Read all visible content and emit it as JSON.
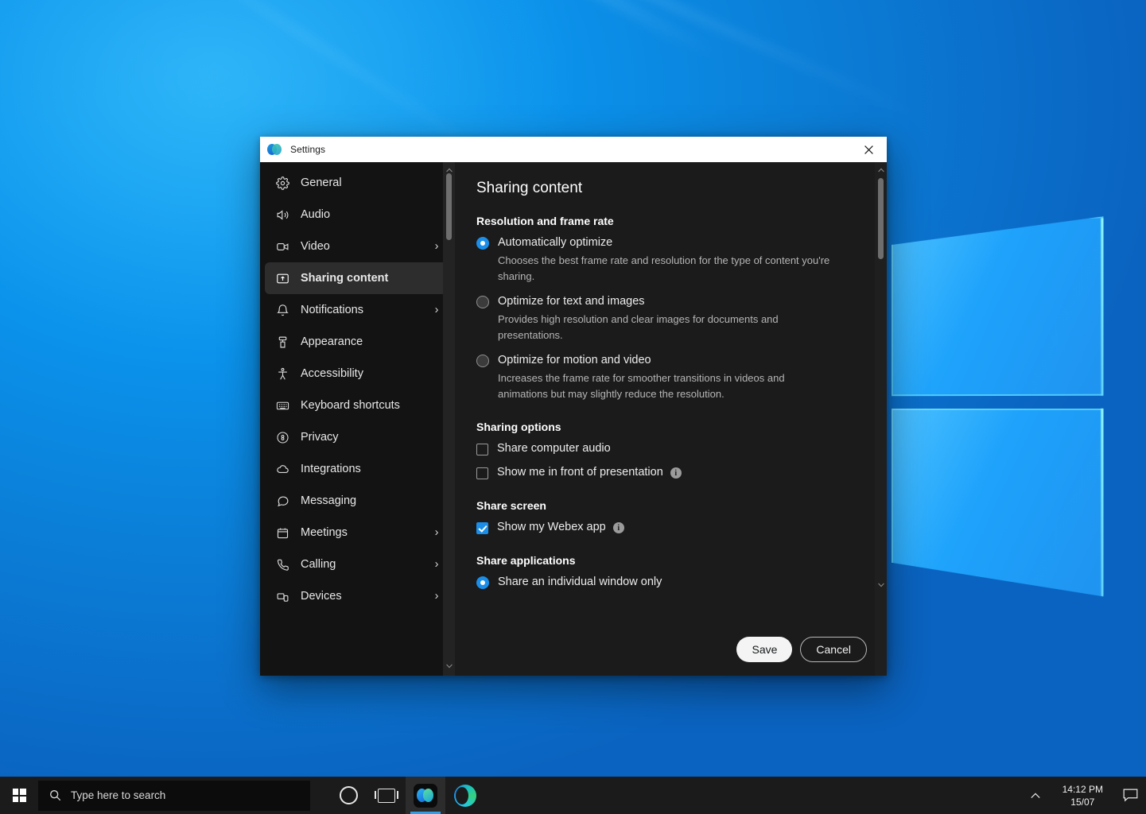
{
  "window": {
    "title": "Settings",
    "logo_icon": "webex-logo-icon",
    "close_icon": "close-icon"
  },
  "sidebar": {
    "items": [
      {
        "label": "General",
        "icon": "gear-icon",
        "chevron": "",
        "selected": false
      },
      {
        "label": "Audio",
        "icon": "speaker-icon",
        "chevron": "",
        "selected": false
      },
      {
        "label": "Video",
        "icon": "camera-icon",
        "chevron": "›",
        "selected": false
      },
      {
        "label": "Sharing content",
        "icon": "share-screen-icon",
        "chevron": "",
        "selected": true
      },
      {
        "label": "Notifications",
        "icon": "bell-icon",
        "chevron": "›",
        "selected": false
      },
      {
        "label": "Appearance",
        "icon": "paint-roller-icon",
        "chevron": "",
        "selected": false
      },
      {
        "label": "Accessibility",
        "icon": "accessibility-icon",
        "chevron": "",
        "selected": false
      },
      {
        "label": "Keyboard shortcuts",
        "icon": "keyboard-icon",
        "chevron": "",
        "selected": false
      },
      {
        "label": "Privacy",
        "icon": "privacy-lock-icon",
        "chevron": "",
        "selected": false
      },
      {
        "label": "Integrations",
        "icon": "cloud-icon",
        "chevron": "",
        "selected": false
      },
      {
        "label": "Messaging",
        "icon": "chat-bubble-icon",
        "chevron": "",
        "selected": false
      },
      {
        "label": "Meetings",
        "icon": "calendar-icon",
        "chevron": "›",
        "selected": false
      },
      {
        "label": "Calling",
        "icon": "phone-icon",
        "chevron": "›",
        "selected": false
      },
      {
        "label": "Devices",
        "icon": "devices-icon",
        "chevron": "›",
        "selected": false
      }
    ]
  },
  "content": {
    "page_title": "Sharing content",
    "sections": [
      {
        "title": "Resolution and frame rate",
        "options": [
          {
            "label": "Automatically optimize",
            "description": "Chooses the best frame rate and resolution for the type of content you're sharing.",
            "checked": true
          },
          {
            "label": "Optimize for text and images",
            "description": "Provides high resolution and clear images for documents and presentations.",
            "checked": false
          },
          {
            "label": "Optimize for motion and video",
            "description": "Increases the frame rate for smoother transitions in videos and animations but may slightly reduce the resolution.",
            "checked": false
          }
        ]
      },
      {
        "title": "Sharing options",
        "checkboxes": [
          {
            "label": "Share computer audio",
            "checked": false,
            "info": false
          },
          {
            "label": "Show me in front of presentation",
            "checked": false,
            "info": true
          }
        ]
      },
      {
        "title": "Share screen",
        "checkboxes": [
          {
            "label": "Show my Webex app",
            "checked": true,
            "info": true
          }
        ]
      },
      {
        "title": "Share applications",
        "options": [
          {
            "label": "Share an individual window only",
            "description": "",
            "checked": true
          }
        ]
      }
    ],
    "info_glyph": "i"
  },
  "footer": {
    "save_label": "Save",
    "cancel_label": "Cancel"
  },
  "taskbar": {
    "start_icon": "windows-start-icon",
    "search_placeholder": "Type here to search",
    "search_icon": "search-icon",
    "cortana_icon": "cortana-icon",
    "taskview_icon": "task-view-icon",
    "webex_icon": "webex-taskbar-icon",
    "edge_icon": "edge-browser-icon",
    "tray_chevron": "chevron-up-icon",
    "clock_time": "14:12 PM",
    "clock_date": "15/07",
    "action_center_icon": "action-center-icon"
  },
  "colors": {
    "accent": "#1a8ee8",
    "window_bg": "#1b1b1b",
    "sidebar_bg": "#131313",
    "selected_bg": "#2d2d2d"
  }
}
